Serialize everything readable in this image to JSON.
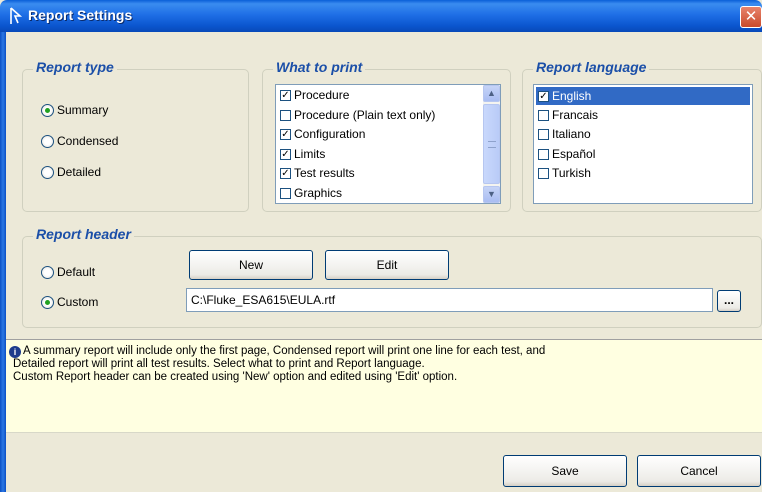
{
  "window": {
    "title": "Report Settings",
    "close_glyph": "✕"
  },
  "report_type": {
    "legend": "Report type",
    "options": [
      {
        "label": "Summary",
        "selected": true
      },
      {
        "label": "Condensed",
        "selected": false
      },
      {
        "label": "Detailed",
        "selected": false
      }
    ]
  },
  "what_to_print": {
    "legend": "What to print",
    "items": [
      {
        "label": "Procedure",
        "checked": true
      },
      {
        "label": "Procedure (Plain text only)",
        "checked": false
      },
      {
        "label": "Configuration",
        "checked": true
      },
      {
        "label": "Limits",
        "checked": true
      },
      {
        "label": "Test results",
        "checked": true
      },
      {
        "label": "Graphics",
        "checked": false
      }
    ]
  },
  "report_language": {
    "legend": "Report language",
    "items": [
      {
        "label": "English",
        "checked": true,
        "selected": true
      },
      {
        "label": "Francais",
        "checked": false,
        "selected": false
      },
      {
        "label": "Italiano",
        "checked": false,
        "selected": false
      },
      {
        "label": "Español",
        "checked": false,
        "selected": false
      },
      {
        "label": "Turkish",
        "checked": false,
        "selected": false
      }
    ]
  },
  "report_header": {
    "legend": "Report header",
    "default_label": "Default",
    "custom_label": "Custom",
    "selected": "custom",
    "new_button": "New",
    "edit_button": "Edit",
    "path_value": "C:\\Fluke_ESA615\\EULA.rtf",
    "browse_button": "..."
  },
  "info": {
    "icon": "info-icon",
    "lines": [
      "A summary report will include only the first page, Condensed report will print one line for each test, and",
      "Detailed report will print all test results. Select what to print and Report language.",
      "Custom Report header can be created using 'New' option and edited using 'Edit' option."
    ]
  },
  "footer": {
    "save_button": "Save",
    "cancel_button": "Cancel"
  },
  "colors": {
    "legend": "#1b4fa8",
    "titlebar": "#0b56cf",
    "selection": "#316ac5",
    "info_bg": "#ffffe1"
  }
}
